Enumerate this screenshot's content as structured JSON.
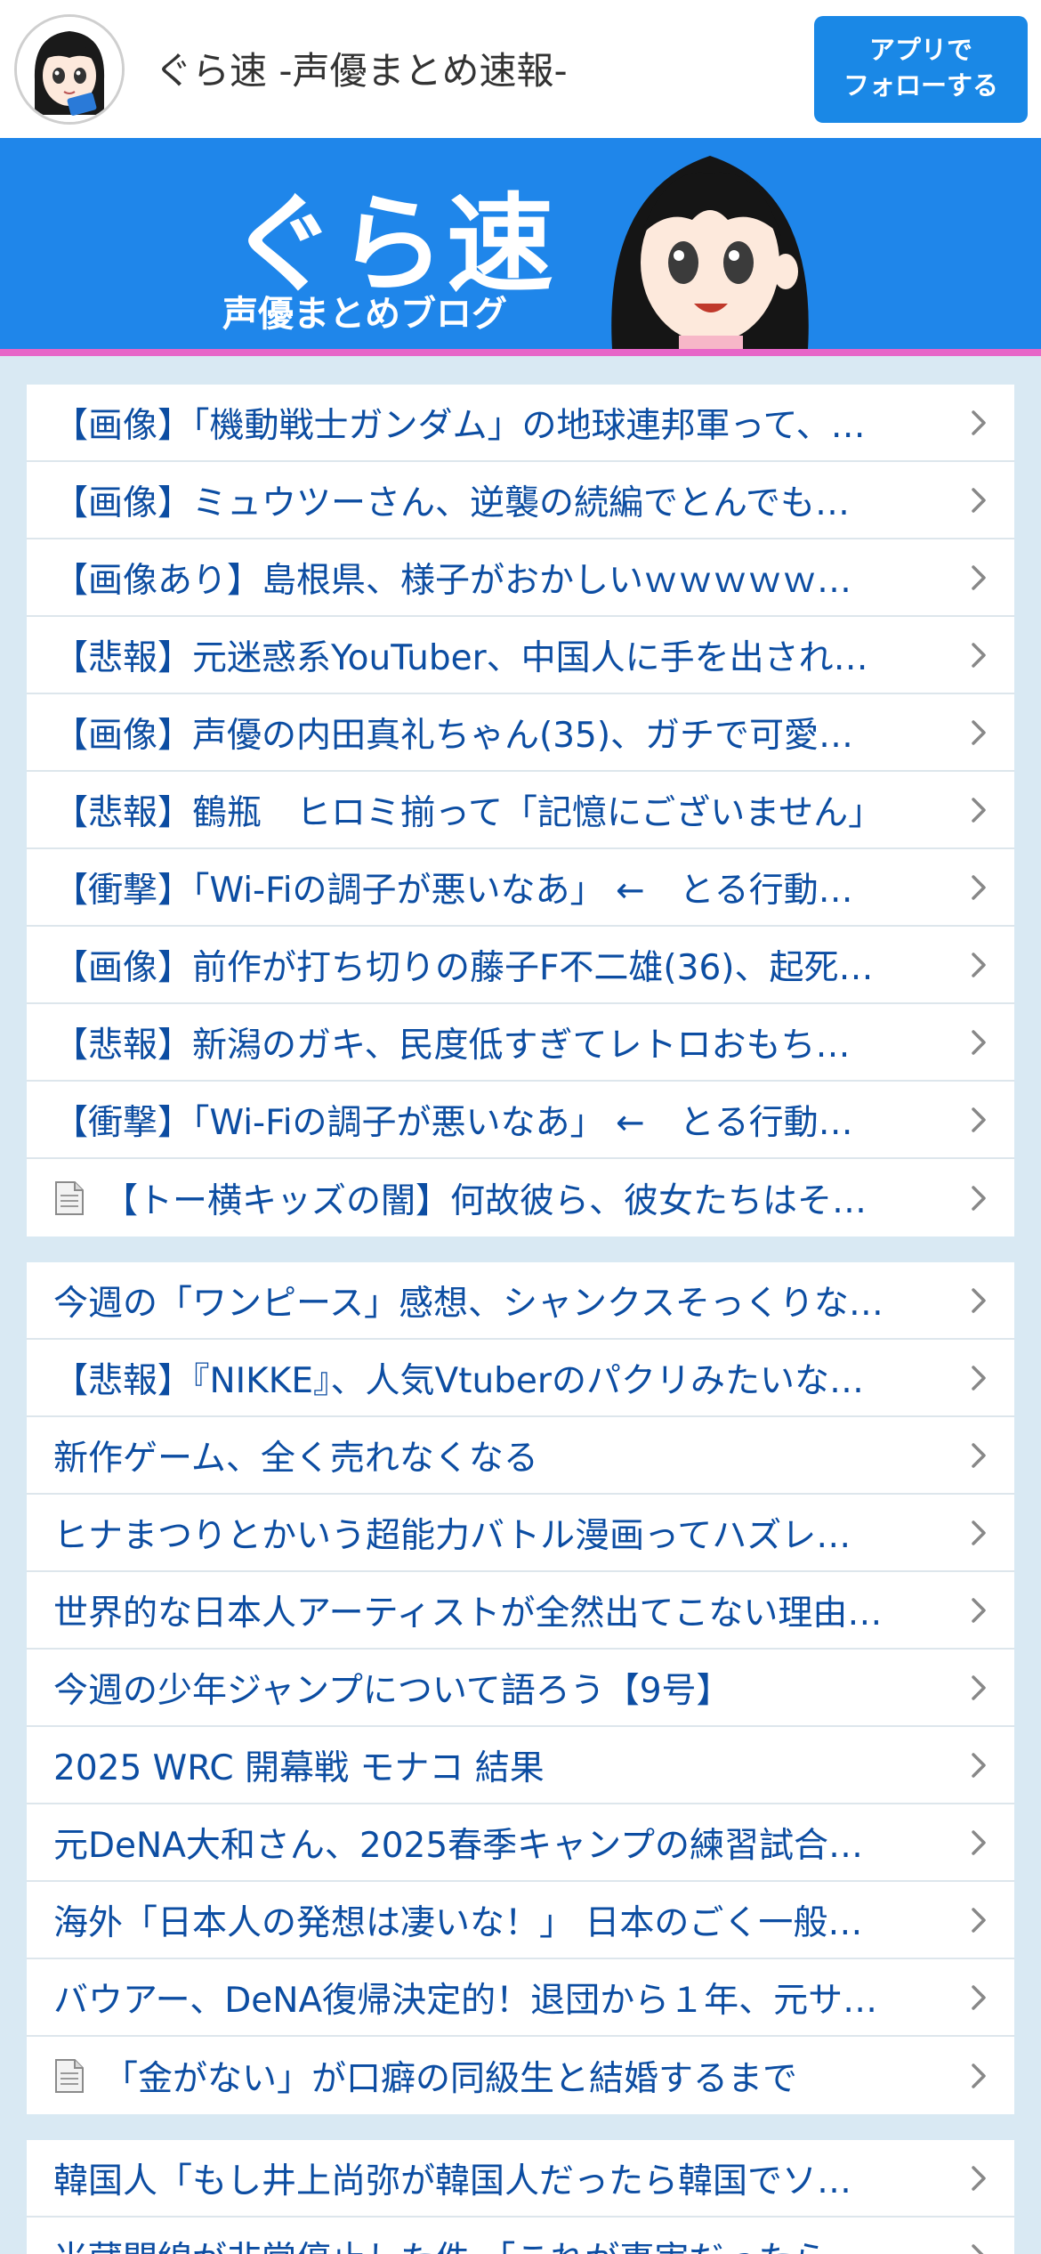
{
  "header": {
    "site_title": "ぐら速 -声優まとめ速報-",
    "follow_button": "アプリで\nフォローする",
    "follow_line1": "アプリで",
    "follow_line2": "フォローする"
  },
  "banner": {
    "title": "ぐら速",
    "subtitle": "声優まとめブログ",
    "colors": {
      "background": "#1f86ea",
      "accent_line": "#e766c8"
    }
  },
  "list1": [
    {
      "text": "【画像】「機動戦士ガンダム」の地球連邦軍って、…",
      "doc": false
    },
    {
      "text": "【画像】ミュウツーさん、逆襲の続編でとんでも…",
      "doc": false
    },
    {
      "text": "【画像あり】島根県、様子がおかしいｗｗｗｗｗ…",
      "doc": false
    },
    {
      "text": "【悲報】元迷惑系YouTuber、中国人に手を出され…",
      "doc": false
    },
    {
      "text": "【画像】声優の内田真礼ちゃん(35)、ガチで可愛…",
      "doc": false
    },
    {
      "text": "【悲報】鶴瓶　ヒロミ揃って「記憶にございません」",
      "doc": false
    },
    {
      "text": "【衝撃】「Wi-Fiの調子が悪いなあ」 ←　とる行動…",
      "doc": false
    },
    {
      "text": "【画像】前作が打ち切りの藤子F不二雄(36)、起死…",
      "doc": false
    },
    {
      "text": "【悲報】新潟のガキ、民度低すぎてレトロおもち…",
      "doc": false
    },
    {
      "text": "【衝撃】「Wi-Fiの調子が悪いなあ」 ←　とる行動…",
      "doc": false
    },
    {
      "text": "【トー横キッズの闇】何故彼ら、彼女たちはそ…",
      "doc": true
    }
  ],
  "list2": [
    {
      "text": "今週の「ワンピース」感想、シャンクスそっくりな…",
      "doc": false
    },
    {
      "text": "【悲報】『NIKKE』、人気Vtuberのパクリみたいな…",
      "doc": false
    },
    {
      "text": "新作ゲーム、全く売れなくなる",
      "doc": false
    },
    {
      "text": "ヒナまつりとかいう超能力バトル漫画ってハズレ…",
      "doc": false
    },
    {
      "text": "世界的な日本人アーティストが全然出てこない理由…",
      "doc": false
    },
    {
      "text": "今週の少年ジャンプについて語ろう【9号】",
      "doc": false
    },
    {
      "text": "2025 WRC 開幕戦 モナコ 結果",
      "doc": false
    },
    {
      "text": "元DeNA大和さん、2025春季キャンプの練習試合…",
      "doc": false
    },
    {
      "text": "海外「日本人の発想は凄いな！」 日本のごく一般…",
      "doc": false
    },
    {
      "text": "バウアー、DeNA復帰決定的！退団から１年、元サ…",
      "doc": false
    },
    {
      "text": "「金がない」が口癖の同級生と結婚するまで",
      "doc": true
    }
  ],
  "list3": [
    {
      "text": "韓国人「もし井上尚弥が韓国人だったら韓国でソ…",
      "doc": false
    },
    {
      "text": "米蔵開線が非常停止した件 「これが事実だったら…",
      "doc": false
    }
  ],
  "icons": {
    "chevron": "chevron-right-icon",
    "document": "document-icon"
  },
  "colors": {
    "link_text": "#0c4da2",
    "page_background": "#d9e9f3",
    "button": "#1a88e6"
  }
}
